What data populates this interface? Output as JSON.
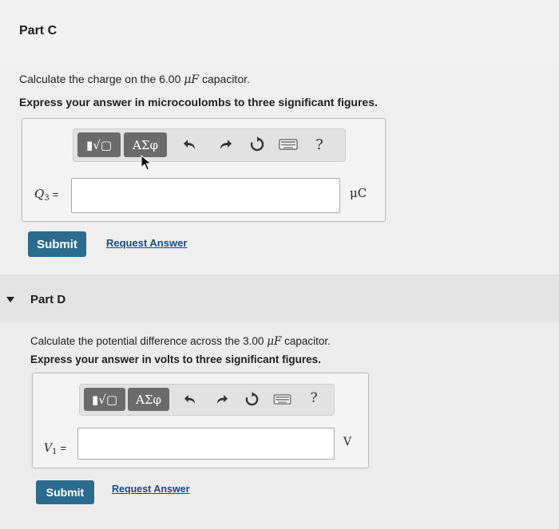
{
  "part_c": {
    "header": "Part C",
    "question_prefix": "Calculate the charge on the 6.00 ",
    "question_unit": "μF",
    "question_suffix": " capacitor.",
    "instruction": "Express your answer in microcoulombs to three significant figures.",
    "toolbar": {
      "templates_label": "▮√▢",
      "greek_label": "ΑΣφ",
      "help_label": "?"
    },
    "variable": "Q",
    "variable_sub": "3",
    "equals": "=",
    "input_value": "",
    "unit": "μC",
    "submit_label": "Submit",
    "request_label": "Request Answer"
  },
  "part_d": {
    "header": "Part D",
    "question_prefix": "Calculate the potential difference across the 3.00 ",
    "question_unit": "μF",
    "question_suffix": " capacitor.",
    "instruction": "Express your answer in volts to three significant figures.",
    "toolbar": {
      "templates_label": "▮√▢",
      "greek_label": "ΑΣφ",
      "help_label": "?"
    },
    "variable": "V",
    "variable_sub": "1",
    "equals": "=",
    "input_value": "",
    "unit": "V",
    "submit_label": "Submit",
    "request_label": "Request Answer"
  },
  "icons": {
    "templates": "templates-icon",
    "greek": "greek-symbols-icon",
    "undo": "undo-arrow-icon",
    "redo": "redo-arrow-icon",
    "reset": "reset-icon",
    "keyboard": "keyboard-icon",
    "help": "help-icon",
    "collapse": "caret-down-icon"
  }
}
